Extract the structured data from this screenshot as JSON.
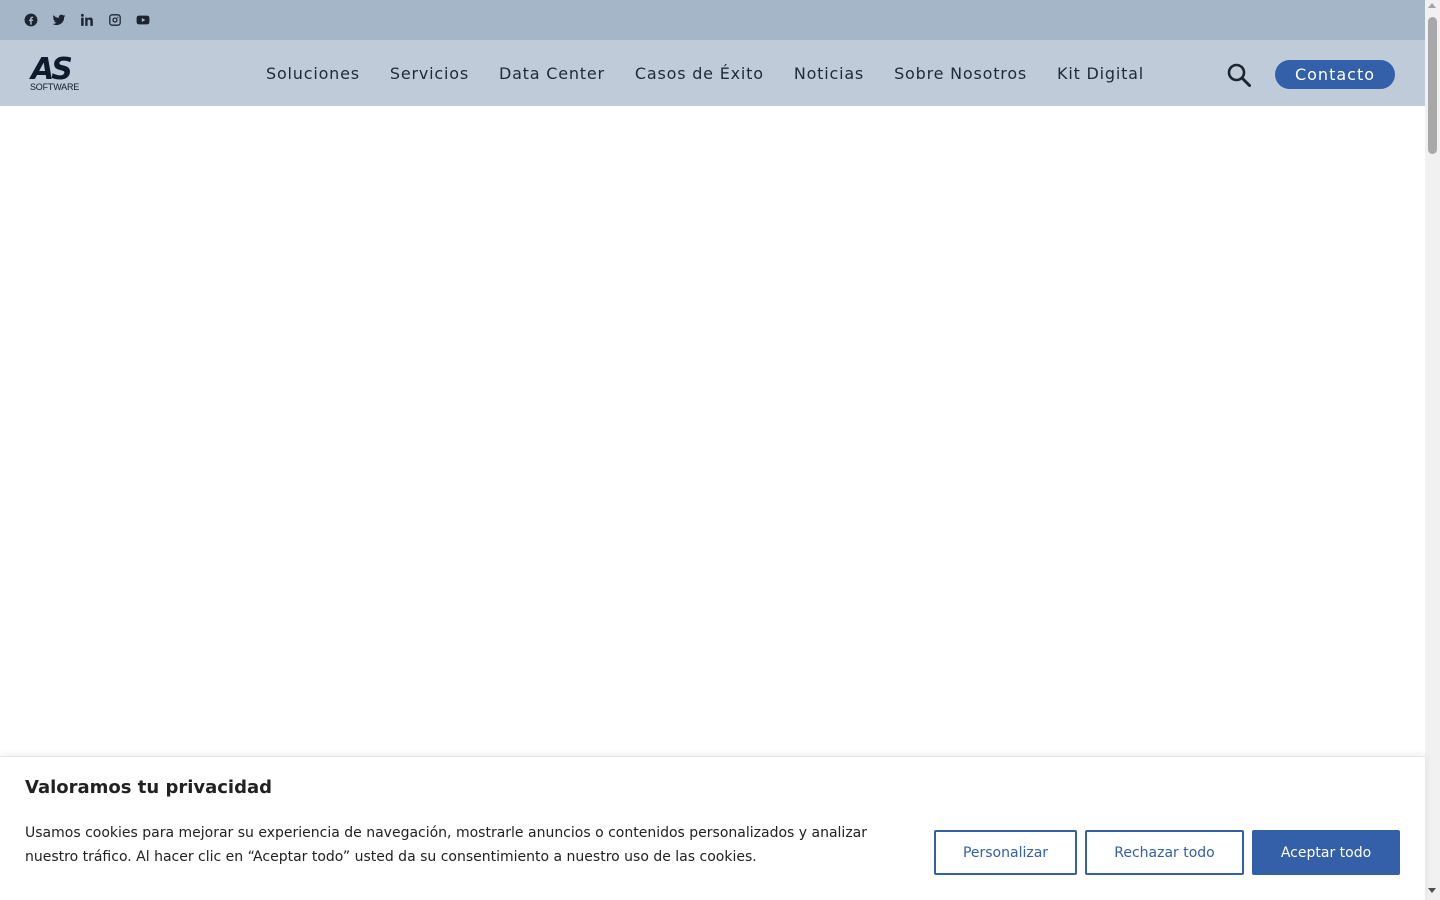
{
  "topbar": {
    "social_icons": [
      "facebook-icon",
      "twitter-icon",
      "linkedin-icon",
      "instagram-icon",
      "youtube-icon"
    ]
  },
  "header": {
    "logo": {
      "main": "AS",
      "sub": "SOFTWARE"
    },
    "nav": [
      "Soluciones",
      "Servicios",
      "Data Center",
      "Casos de Éxito",
      "Noticias",
      "Sobre Nosotros",
      "Kit Digital"
    ],
    "search_icon": "search-icon",
    "contact_label": "Contacto"
  },
  "cookie_banner": {
    "title": "Valoramos tu privacidad",
    "text": "Usamos cookies para mejorar su experiencia de navegación, mostrarle anuncios o contenidos personalizados y analizar nuestro tráfico. Al hacer clic en “Aceptar todo” usted da su consentimiento a nuestro uso de las cookies.",
    "customize_label": "Personalizar",
    "reject_label": "Rechazar todo",
    "accept_label": "Aceptar todo"
  },
  "colors": {
    "topbar_bg": "#a6b6c9",
    "navbar_bg": "#bfcbd9",
    "accent": "#3360a8",
    "text": "#1f2a37"
  }
}
